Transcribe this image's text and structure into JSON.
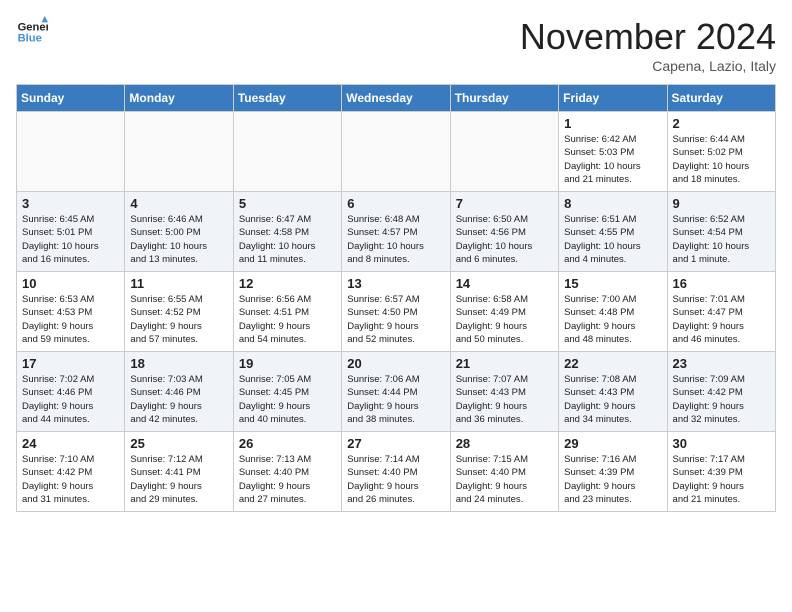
{
  "header": {
    "logo_line1": "General",
    "logo_line2": "Blue",
    "month_title": "November 2024",
    "location": "Capena, Lazio, Italy"
  },
  "weekdays": [
    "Sunday",
    "Monday",
    "Tuesday",
    "Wednesday",
    "Thursday",
    "Friday",
    "Saturday"
  ],
  "weeks": [
    [
      {
        "day": "",
        "info": ""
      },
      {
        "day": "",
        "info": ""
      },
      {
        "day": "",
        "info": ""
      },
      {
        "day": "",
        "info": ""
      },
      {
        "day": "",
        "info": ""
      },
      {
        "day": "1",
        "info": "Sunrise: 6:42 AM\nSunset: 5:03 PM\nDaylight: 10 hours\nand 21 minutes."
      },
      {
        "day": "2",
        "info": "Sunrise: 6:44 AM\nSunset: 5:02 PM\nDaylight: 10 hours\nand 18 minutes."
      }
    ],
    [
      {
        "day": "3",
        "info": "Sunrise: 6:45 AM\nSunset: 5:01 PM\nDaylight: 10 hours\nand 16 minutes."
      },
      {
        "day": "4",
        "info": "Sunrise: 6:46 AM\nSunset: 5:00 PM\nDaylight: 10 hours\nand 13 minutes."
      },
      {
        "day": "5",
        "info": "Sunrise: 6:47 AM\nSunset: 4:58 PM\nDaylight: 10 hours\nand 11 minutes."
      },
      {
        "day": "6",
        "info": "Sunrise: 6:48 AM\nSunset: 4:57 PM\nDaylight: 10 hours\nand 8 minutes."
      },
      {
        "day": "7",
        "info": "Sunrise: 6:50 AM\nSunset: 4:56 PM\nDaylight: 10 hours\nand 6 minutes."
      },
      {
        "day": "8",
        "info": "Sunrise: 6:51 AM\nSunset: 4:55 PM\nDaylight: 10 hours\nand 4 minutes."
      },
      {
        "day": "9",
        "info": "Sunrise: 6:52 AM\nSunset: 4:54 PM\nDaylight: 10 hours\nand 1 minute."
      }
    ],
    [
      {
        "day": "10",
        "info": "Sunrise: 6:53 AM\nSunset: 4:53 PM\nDaylight: 9 hours\nand 59 minutes."
      },
      {
        "day": "11",
        "info": "Sunrise: 6:55 AM\nSunset: 4:52 PM\nDaylight: 9 hours\nand 57 minutes."
      },
      {
        "day": "12",
        "info": "Sunrise: 6:56 AM\nSunset: 4:51 PM\nDaylight: 9 hours\nand 54 minutes."
      },
      {
        "day": "13",
        "info": "Sunrise: 6:57 AM\nSunset: 4:50 PM\nDaylight: 9 hours\nand 52 minutes."
      },
      {
        "day": "14",
        "info": "Sunrise: 6:58 AM\nSunset: 4:49 PM\nDaylight: 9 hours\nand 50 minutes."
      },
      {
        "day": "15",
        "info": "Sunrise: 7:00 AM\nSunset: 4:48 PM\nDaylight: 9 hours\nand 48 minutes."
      },
      {
        "day": "16",
        "info": "Sunrise: 7:01 AM\nSunset: 4:47 PM\nDaylight: 9 hours\nand 46 minutes."
      }
    ],
    [
      {
        "day": "17",
        "info": "Sunrise: 7:02 AM\nSunset: 4:46 PM\nDaylight: 9 hours\nand 44 minutes."
      },
      {
        "day": "18",
        "info": "Sunrise: 7:03 AM\nSunset: 4:46 PM\nDaylight: 9 hours\nand 42 minutes."
      },
      {
        "day": "19",
        "info": "Sunrise: 7:05 AM\nSunset: 4:45 PM\nDaylight: 9 hours\nand 40 minutes."
      },
      {
        "day": "20",
        "info": "Sunrise: 7:06 AM\nSunset: 4:44 PM\nDaylight: 9 hours\nand 38 minutes."
      },
      {
        "day": "21",
        "info": "Sunrise: 7:07 AM\nSunset: 4:43 PM\nDaylight: 9 hours\nand 36 minutes."
      },
      {
        "day": "22",
        "info": "Sunrise: 7:08 AM\nSunset: 4:43 PM\nDaylight: 9 hours\nand 34 minutes."
      },
      {
        "day": "23",
        "info": "Sunrise: 7:09 AM\nSunset: 4:42 PM\nDaylight: 9 hours\nand 32 minutes."
      }
    ],
    [
      {
        "day": "24",
        "info": "Sunrise: 7:10 AM\nSunset: 4:42 PM\nDaylight: 9 hours\nand 31 minutes."
      },
      {
        "day": "25",
        "info": "Sunrise: 7:12 AM\nSunset: 4:41 PM\nDaylight: 9 hours\nand 29 minutes."
      },
      {
        "day": "26",
        "info": "Sunrise: 7:13 AM\nSunset: 4:40 PM\nDaylight: 9 hours\nand 27 minutes."
      },
      {
        "day": "27",
        "info": "Sunrise: 7:14 AM\nSunset: 4:40 PM\nDaylight: 9 hours\nand 26 minutes."
      },
      {
        "day": "28",
        "info": "Sunrise: 7:15 AM\nSunset: 4:40 PM\nDaylight: 9 hours\nand 24 minutes."
      },
      {
        "day": "29",
        "info": "Sunrise: 7:16 AM\nSunset: 4:39 PM\nDaylight: 9 hours\nand 23 minutes."
      },
      {
        "day": "30",
        "info": "Sunrise: 7:17 AM\nSunset: 4:39 PM\nDaylight: 9 hours\nand 21 minutes."
      }
    ]
  ]
}
